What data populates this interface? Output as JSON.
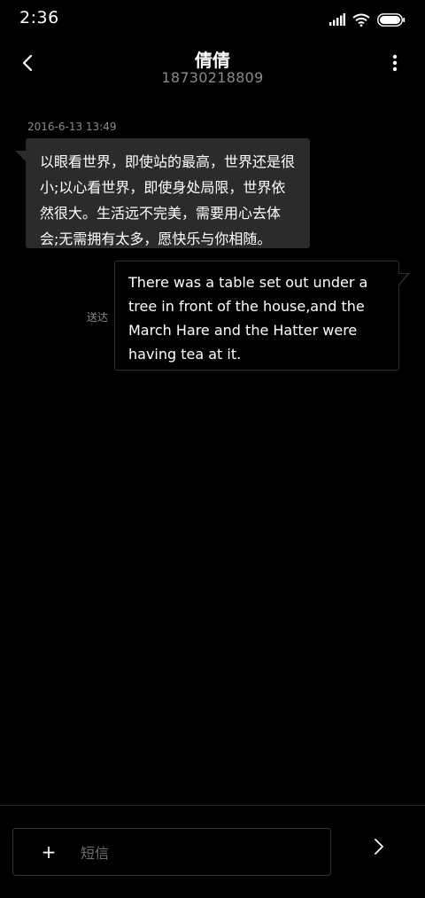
{
  "status_bar": {
    "time": "2:36",
    "icons": [
      "signal-icon",
      "wifi-icon",
      "battery-icon"
    ]
  },
  "header": {
    "contact_name": "倩倩",
    "contact_number": "18730218809",
    "back_icon": "back-chevron-icon",
    "more_icon": "more-vertical-icon"
  },
  "messages": [
    {
      "direction": "incoming",
      "timestamp": "2016-6-13 13:49",
      "text": "以眼看世界，即使站的最高，世界还是很小;以心看世界，即使身处局限，世界依然很大。生活远不完美，需要用心去体会;无需拥有太多，愿快乐与你相随。"
    },
    {
      "direction": "outgoing",
      "status": "送达",
      "text": "There was a table set out under a tree in front of the house,and the March Hare and the Hatter were having tea at it."
    }
  ],
  "composer": {
    "attach_label": "+",
    "placeholder": "短信",
    "value": "",
    "send_icon": "send-chevron-icon"
  },
  "colors": {
    "background": "#000000",
    "incoming_bubble": "#2b2b2b",
    "outgoing_bubble_border": "#2e2e2e",
    "secondary_text": "#8a8a8a"
  }
}
